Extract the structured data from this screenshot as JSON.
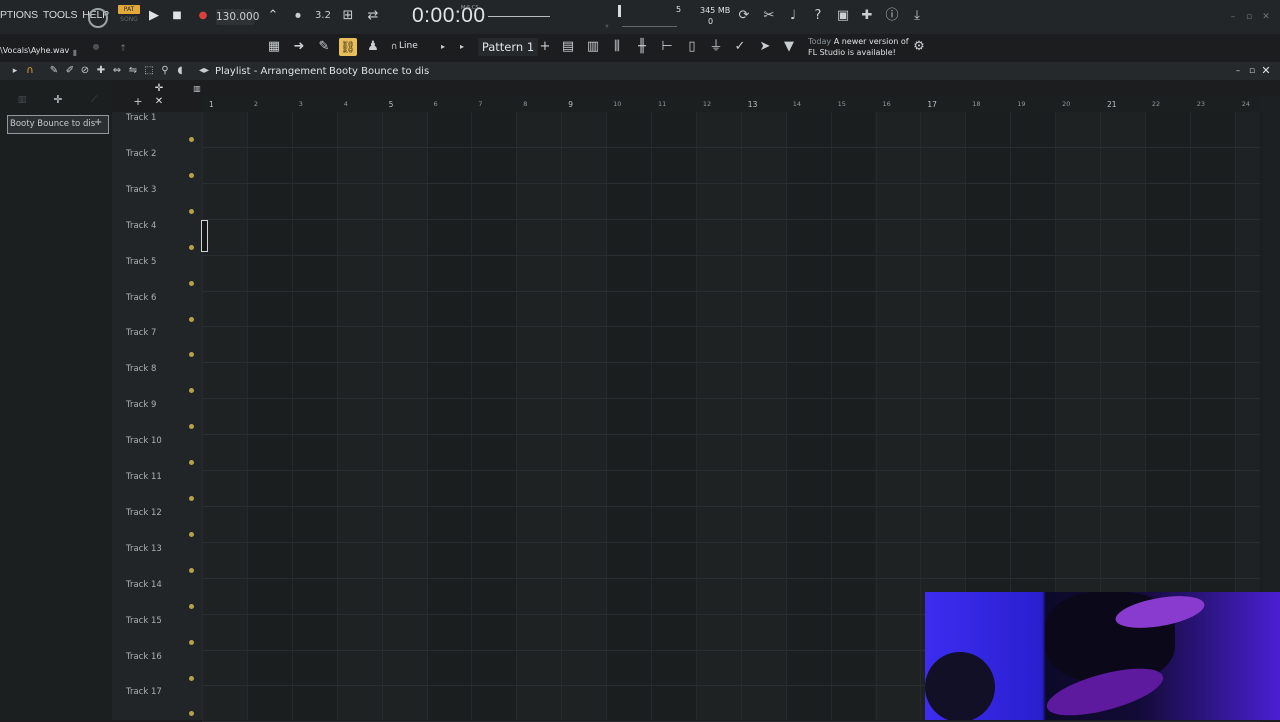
{
  "menu": [
    "PTIONS",
    "TOOLS",
    "HELP"
  ],
  "transport": {
    "pat_label": "PAT",
    "song_label": "SONG",
    "tempo": "130.000",
    "time": "0:00:00",
    "time_unit": "M:S:CS",
    "cpu_label": "5",
    "memory": "345 MB",
    "polyphony": "0"
  },
  "loaded_file": "\\Vocals\\Ayhe.wav",
  "toolbar": {
    "snap_label": "Line",
    "pattern_selector": "Pattern 1"
  },
  "news": {
    "date": "Today",
    "message": "A newer version of FL Studio is available!"
  },
  "playlist": {
    "title": "Playlist - Arrangement",
    "separator": "›",
    "current_pattern": "Booty Bounce to dis",
    "pattern_box_label": "Booty Bounce to dis",
    "pattern_box_plus": "+",
    "bar_numbers": [
      "1",
      "2",
      "3",
      "4",
      "5",
      "6",
      "7",
      "8",
      "9",
      "10",
      "11",
      "12",
      "13",
      "14",
      "15",
      "16",
      "17",
      "18",
      "19",
      "20",
      "21",
      "22",
      "23",
      "24"
    ],
    "tracks": [
      "Track 1",
      "Track 2",
      "Track 3",
      "Track 4",
      "Track 5",
      "Track 6",
      "Track 7",
      "Track 8",
      "Track 9",
      "Track 10",
      "Track 11",
      "Track 12",
      "Track 13",
      "Track 14",
      "Track 15",
      "Track 16",
      "Track 17"
    ]
  },
  "colors": {
    "accent": "#e8bf58",
    "record": "#d9423b",
    "pattern_active": "#e2a93a"
  }
}
